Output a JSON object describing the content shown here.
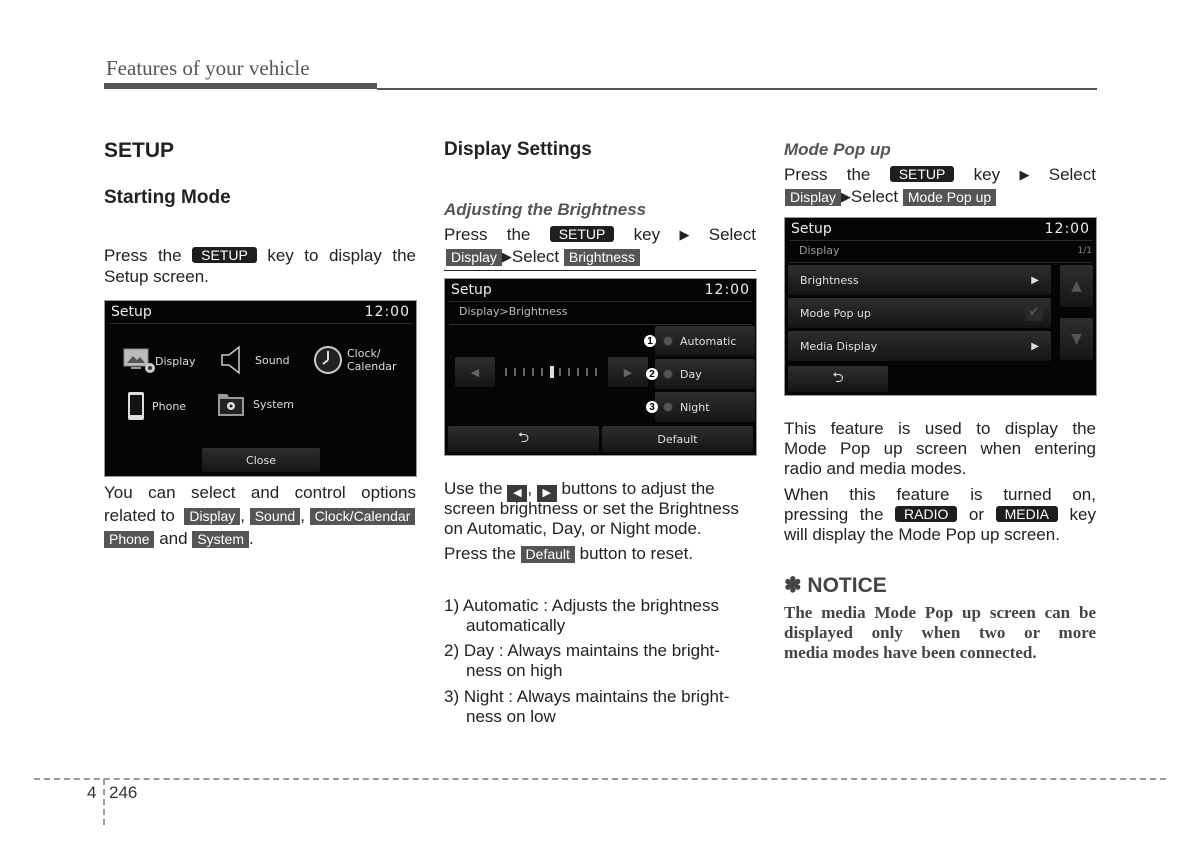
{
  "header": {
    "running_title": "Features of your vehicle"
  },
  "col1": {
    "title": "SETUP",
    "subtitle": "Starting Mode",
    "intro_pre": "Press the",
    "intro_key": "SETUP",
    "intro_post": "key to display the",
    "intro_line2": "Setup screen.",
    "screen": {
      "title": "Setup",
      "time": "12:00",
      "items": [
        {
          "label": "Display",
          "icon": "display-settings-icon"
        },
        {
          "label": "Sound",
          "icon": "speaker-icon"
        },
        {
          "label": "Clock/",
          "label2": "Calendar",
          "icon": "clock-icon"
        },
        {
          "label": "Phone",
          "icon": "phone-icon"
        },
        {
          "label": "System",
          "icon": "system-folder-icon"
        }
      ],
      "close_label": "Close"
    },
    "options_line1": "You can select and control options",
    "options_pre": "related to",
    "keys": [
      "Display",
      "Sound",
      "Clock/Calendar",
      "Phone",
      "System"
    ],
    "and": "and",
    "comma": ",",
    "period": "."
  },
  "col2": {
    "title": "Display Settings",
    "subtitle": "Adjusting the Brightness",
    "press_the": "Press the",
    "setup_key": "SETUP",
    "key_word": "key",
    "select": "Select",
    "display_key": "Display",
    "brightness_key": "Brightness",
    "screen": {
      "title": "Setup",
      "time": "12:00",
      "breadcrumb": "Display>Brightness",
      "slider_value": 5,
      "slider_max": 10,
      "options": [
        {
          "num": "1",
          "label": "Automatic"
        },
        {
          "num": "2",
          "label": "Day"
        },
        {
          "num": "3",
          "label": "Night"
        }
      ],
      "default_label": "Default"
    },
    "use_pre": "Use the",
    "use_post": "buttons to adjust the",
    "use_line2": "screen brightness or set the Brightness",
    "use_line3": "on Automatic, Day, or Night mode.",
    "reset_pre": "Press the",
    "reset_key": "Default",
    "reset_post": "button to reset.",
    "list": [
      {
        "marker": "1)",
        "line1": "Automatic : Adjusts the brightness",
        "line2": "automatically"
      },
      {
        "marker": "2)",
        "line1": "Day : Always maintains the bright-",
        "line2": "ness on high"
      },
      {
        "marker": "3)",
        "line1": "Night : Always maintains the bright-",
        "line2": "ness on low"
      }
    ]
  },
  "col3": {
    "subtitle": "Mode Pop up",
    "press_the": "Press the",
    "setup_key": "SETUP",
    "key_word": "key",
    "select": "Select",
    "display_key": "Display",
    "mode_key": "Mode Pop up",
    "screen": {
      "title": "Setup",
      "time": "12:00",
      "section": "Display",
      "page": "1/1",
      "items": [
        {
          "label": "Brightness",
          "control": "arrow"
        },
        {
          "label": "Mode Pop up",
          "control": "checkbox",
          "checked": true
        },
        {
          "label": "Media Display",
          "control": "arrow"
        }
      ]
    },
    "desc_line1": "This feature is used to display the",
    "desc_line2": "Mode Pop up screen when entering",
    "desc_line3": "radio and media modes.",
    "when_line1": "When this feature is turned on,",
    "when_pre": "pressing the",
    "radio_key": "RADIO",
    "or": "or",
    "media_key": "MEDIA",
    "when_line3": "will display the Mode Pop up screen.",
    "notice_title": "✽ NOTICE",
    "notice_line1": "The media Mode Pop up screen can be",
    "notice_line2": "displayed only when two or more",
    "notice_line3": "media modes have been connected."
  },
  "footer": {
    "chapter": "4",
    "page": "246"
  }
}
